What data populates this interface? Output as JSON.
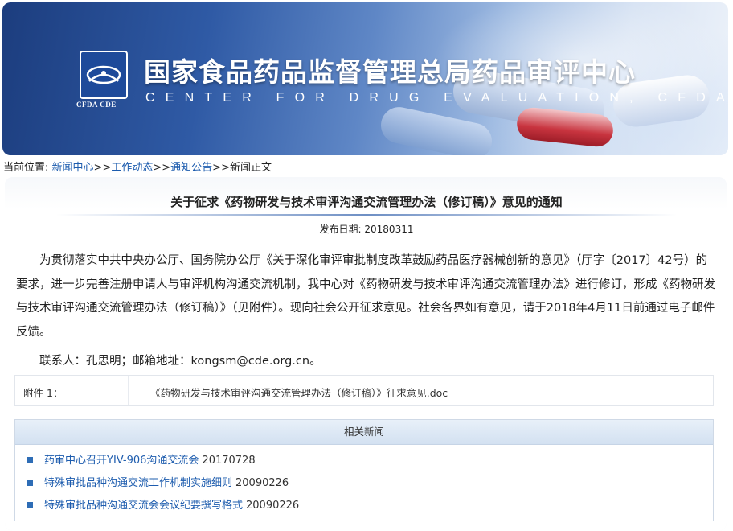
{
  "header": {
    "title_cn": "国家食品药品监督管理总局药品审评中心",
    "title_en": "CENTER FOR DRUG EVALUATION, CFDA",
    "logo_text": "CFDA CDE"
  },
  "breadcrumb": {
    "prefix": "当前位置:",
    "items": [
      "新闻中心",
      "工作动态",
      "通知公告",
      "新闻正文"
    ],
    "separator": ">>"
  },
  "article": {
    "title": "关于征求《药物研发与技术审评沟通交流管理办法（修订稿）》意见的通知",
    "pub_date_label": "发布日期:",
    "pub_date": "20180311",
    "paragraph": "为贯彻落实中共中央办公厅、国务院办公厅《关于深化审评审批制度改革鼓励药品医疗器械创新的意见》（厅字〔2017〕42号）的要求，进一步完善注册申请人与审评机构沟通交流机制，我中心对《药物研发与技术审评沟通交流管理办法》进行修订，形成《药物研发与技术审评沟通交流管理办法（修订稿）》（见附件）。现向社会公开征求意见。社会各界如有意见，请于2018年4月11日前通过电子邮件反馈。",
    "contact": "联系人：孔思明；邮箱地址：kongsm@cde.org.cn。"
  },
  "attachment": {
    "label": "附件 1：",
    "file": "《药物研发与技术审评沟通交流管理办法（修订稿）》征求意见.doc"
  },
  "related_news": {
    "heading": "相关新闻",
    "items": [
      {
        "title": "药审中心召开YIV-906沟通交流会",
        "date": "20170728"
      },
      {
        "title": "特殊审批品种沟通交流工作机制实施细则",
        "date": "20090226"
      },
      {
        "title": "特殊审批品种沟通交流会会议纪要撰写格式",
        "date": "20090226"
      }
    ]
  },
  "colors": {
    "link": "#1d5cae",
    "banner_dark": "#1c3d7e",
    "bullet": "#2e6db6"
  }
}
